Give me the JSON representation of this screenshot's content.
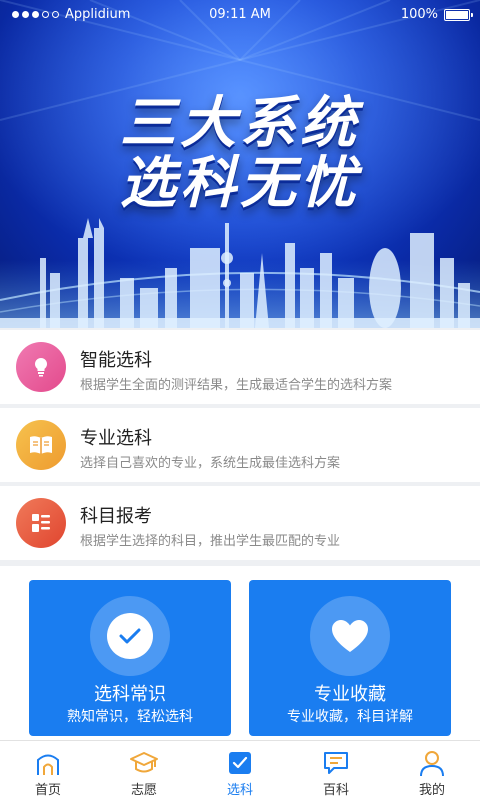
{
  "status_bar": {
    "carrier": "Applidium",
    "time": "09:11 AM",
    "battery": "100%",
    "battery_level": 1.0
  },
  "hero": {
    "line1": "三大系统",
    "line2": "选科无忧"
  },
  "features": [
    {
      "title": "智能选科",
      "desc": "根据学生全面的测评结果，生成最适合学生的选科方案",
      "icon": "lightbulb-icon",
      "color": "#e85a9a"
    },
    {
      "title": "专业选科",
      "desc": "选择自己喜欢的专业，系统生成最佳选科方案",
      "icon": "book-icon",
      "color": "#f0a73a"
    },
    {
      "title": "科目报考",
      "desc": "根据学生选择的科目，推出学生最匹配的专业",
      "icon": "list-icon",
      "color": "#e8593d"
    }
  ],
  "cards": [
    {
      "title": "选科常识",
      "sub": "熟知常识，轻松选科",
      "icon": "check-icon"
    },
    {
      "title": "专业收藏",
      "sub": "专业收藏，科目详解",
      "icon": "heart-icon"
    }
  ],
  "nav": [
    {
      "label": "首页",
      "icon": "home-icon",
      "active": false
    },
    {
      "label": "志愿",
      "icon": "graduation-cap-icon",
      "active": false
    },
    {
      "label": "选科",
      "icon": "checkbox-icon",
      "active": true
    },
    {
      "label": "百科",
      "icon": "message-icon",
      "active": false
    },
    {
      "label": "我的",
      "icon": "user-icon",
      "active": false
    }
  ],
  "colors": {
    "accent": "#1a7df0",
    "hero_blue": "#1243d6",
    "nav_icon_orange": "#f0a73a"
  }
}
